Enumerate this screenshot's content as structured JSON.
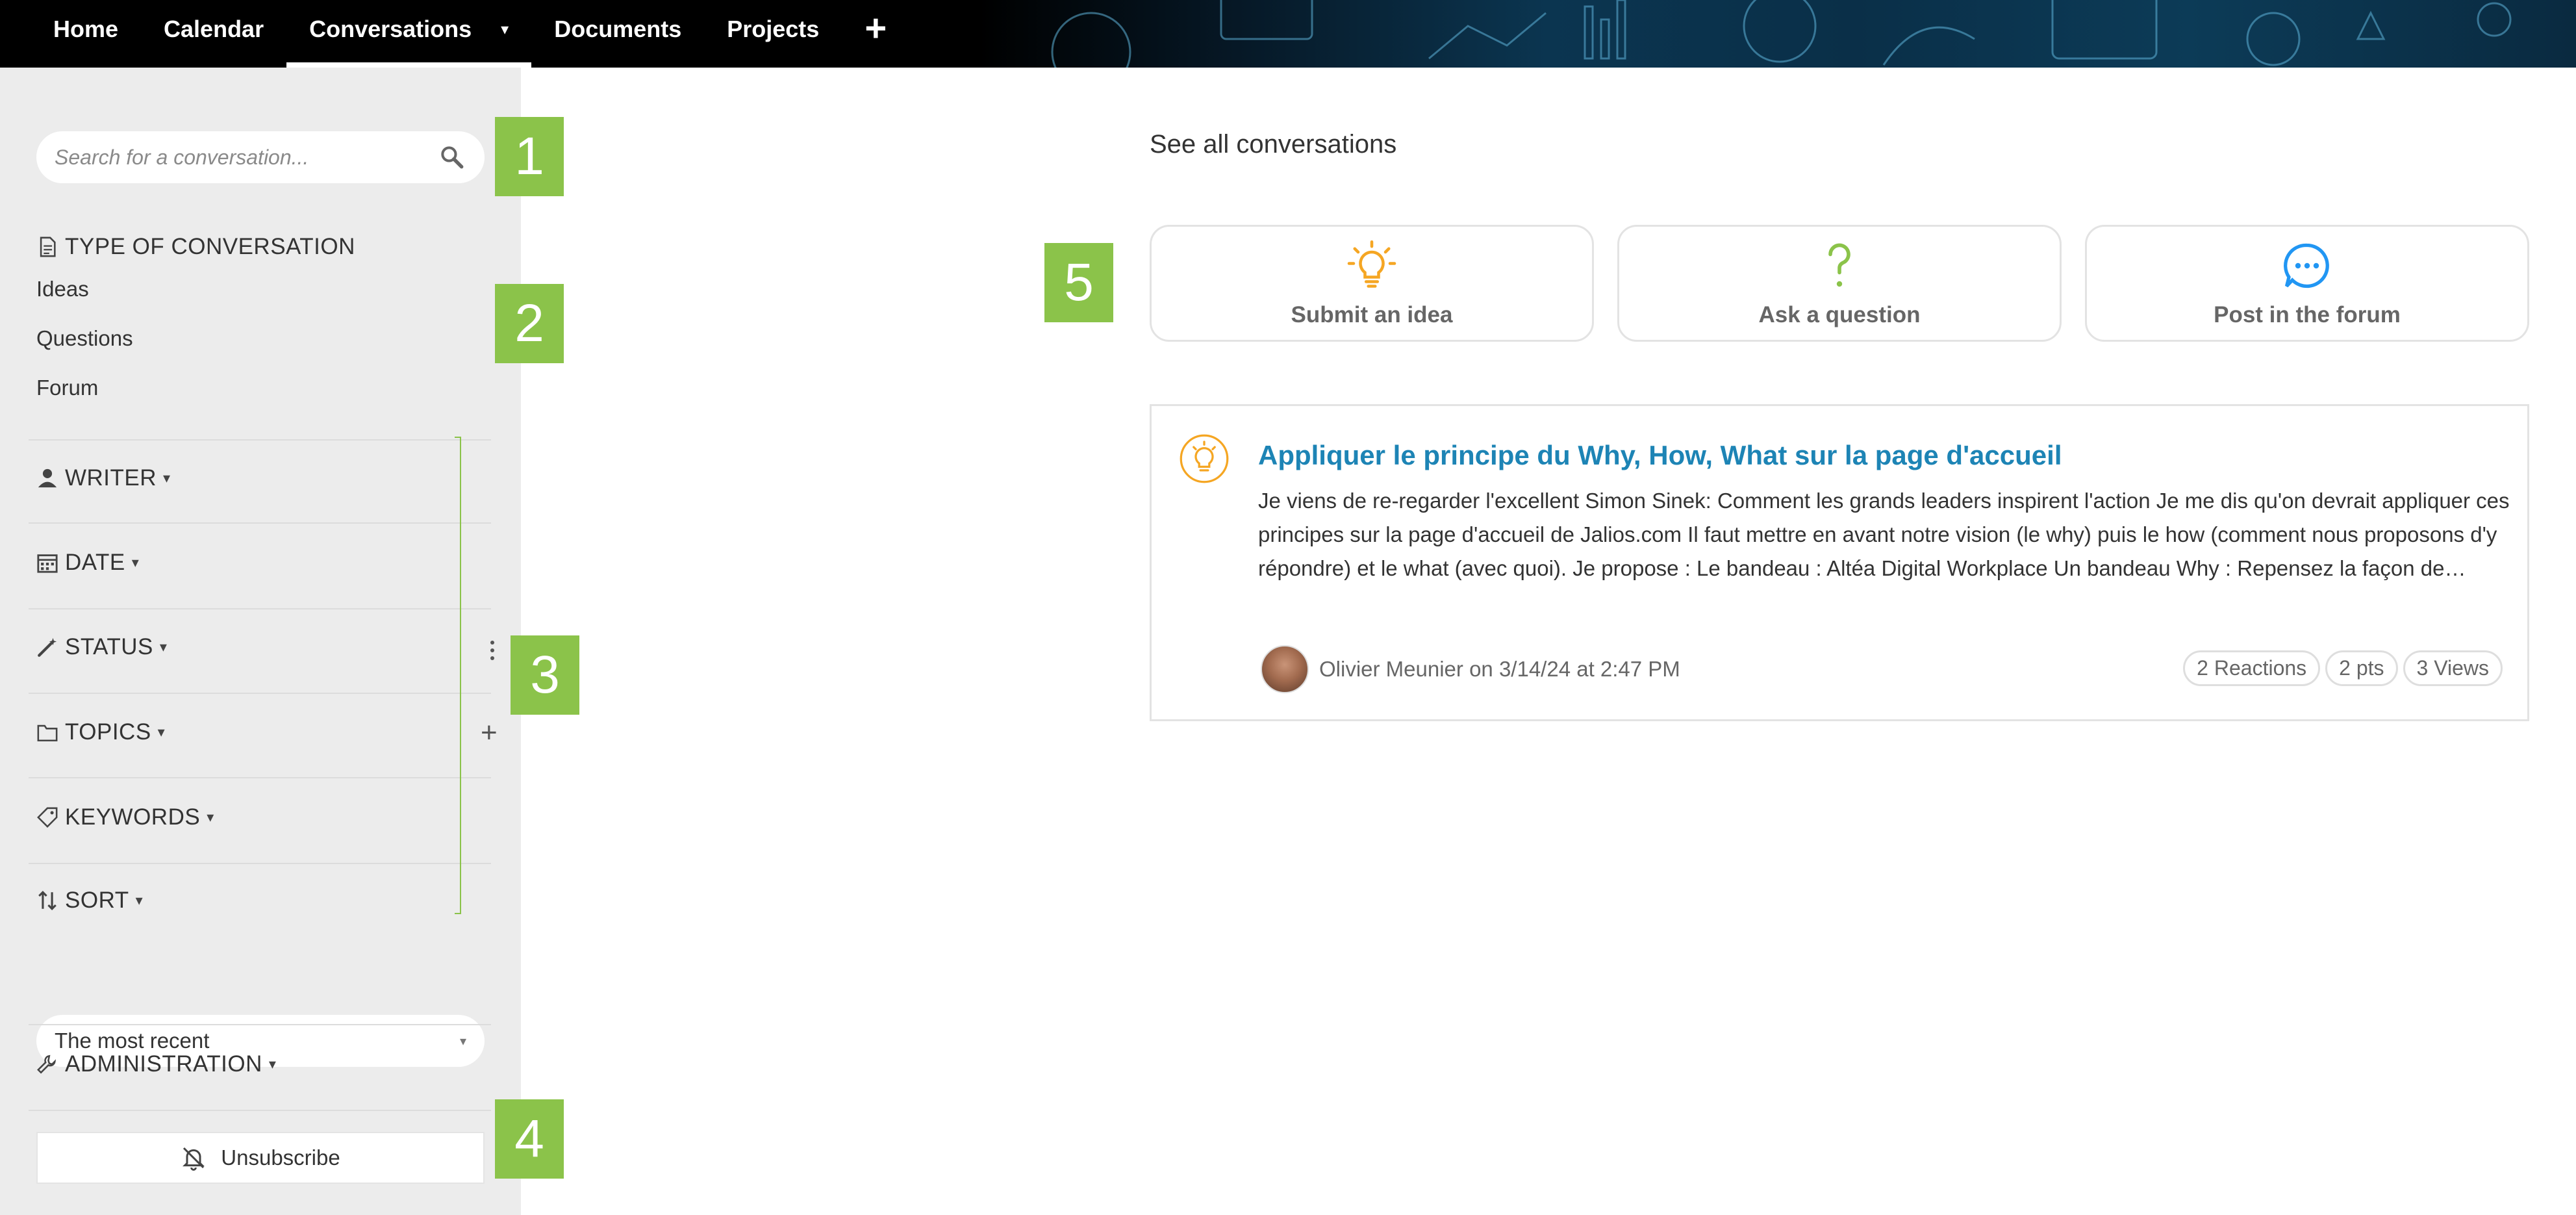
{
  "nav": {
    "items": [
      {
        "label": "Home",
        "active": false
      },
      {
        "label": "Calendar",
        "active": false
      },
      {
        "label": "Conversations",
        "active": true
      },
      {
        "label": "Documents",
        "active": false
      },
      {
        "label": "Projects",
        "active": false
      }
    ],
    "add_icon": "plus-icon",
    "dropdown_icon": "caret-down-icon"
  },
  "sidebar": {
    "search": {
      "placeholder": "Search for a conversation...",
      "value": "",
      "icon": "search-icon"
    },
    "type_title": "TYPE OF CONVERSATION",
    "type_icon": "document-icon",
    "types": [
      "Ideas",
      "Questions",
      "Forum"
    ],
    "filters": [
      {
        "label": "WRITER",
        "icon": "user-icon"
      },
      {
        "label": "DATE",
        "icon": "calendar-icon"
      },
      {
        "label": "STATUS",
        "icon": "magic-wand-icon"
      },
      {
        "label": "TOPICS",
        "icon": "folder-icon"
      },
      {
        "label": "KEYWORDS",
        "icon": "tag-icon"
      },
      {
        "label": "SORT",
        "icon": "sort-icon"
      }
    ],
    "sort_value": "The most recent",
    "administration": {
      "label": "ADMINISTRATION",
      "icon": "wrench-icon"
    },
    "unsubscribe": {
      "label": "Unsubscribe",
      "icon": "bell-off-icon"
    }
  },
  "markers": [
    "1",
    "2",
    "3",
    "4",
    "5"
  ],
  "main": {
    "see_all": "See all conversations",
    "actions": [
      {
        "label": "Submit an idea",
        "icon": "lightbulb-icon",
        "color": "#f5a623"
      },
      {
        "label": "Ask a question",
        "icon": "question-icon",
        "color": "#8bc34a"
      },
      {
        "label": "Post in the forum",
        "icon": "chat-bubble-icon",
        "color": "#2196f3"
      }
    ],
    "conversation": {
      "icon": "lightbulb-icon",
      "title": "Appliquer le principe du Why, How, What sur la page d'accueil",
      "body": "Je viens de re-regarder l'excellent Simon Sinek: Comment les grands leaders inspirent l'action Je me dis qu'on devrait appliquer ces principes sur la page d'accueil de Jalios.com Il faut mettre en avant notre vision (le why) puis le how (comment nous proposons d'y répondre) et le what (avec quoi). Je propose : Le bandeau : Altéa Digital Workplace Un bandeau Why : Repensez la façon de…",
      "author": "Olivier Meunier on 3/14/24 at 2:47 PM",
      "stats": [
        "2 Reactions",
        "2 pts",
        "3 Views"
      ]
    }
  },
  "colors": {
    "accent_green": "#8bc34a",
    "link_blue": "#1d84b5",
    "idea_orange": "#f5a623",
    "forum_blue": "#2196f3"
  }
}
